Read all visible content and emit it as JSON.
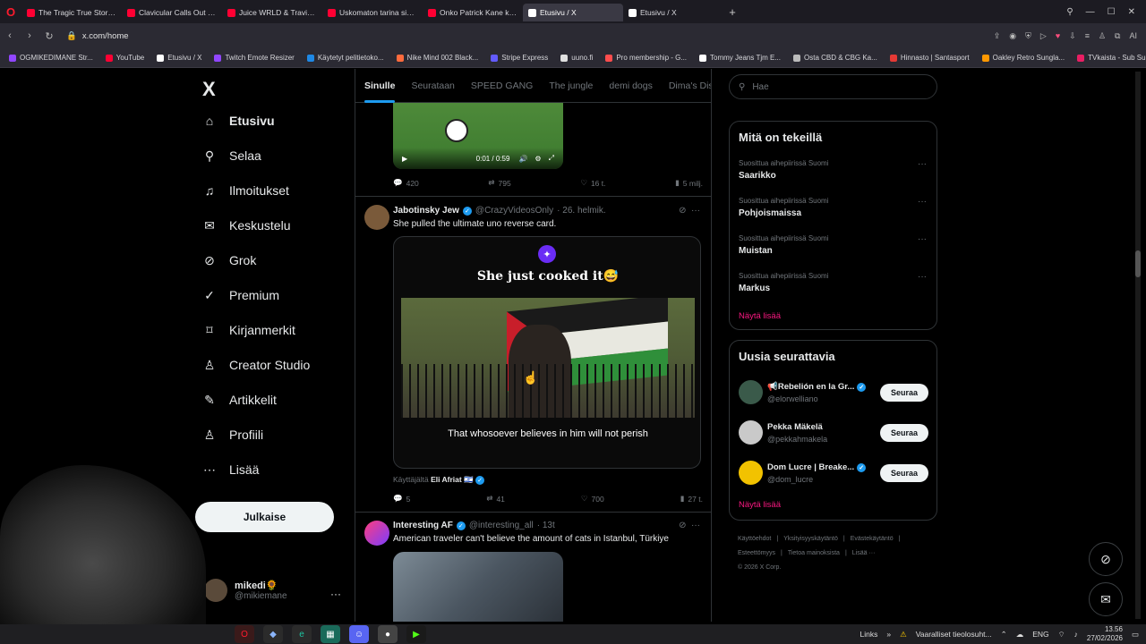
{
  "browser": {
    "tabs": [
      {
        "title": "The Tragic True Story of Ju",
        "color": "#ff0033"
      },
      {
        "title": "Clavicular Calls Out Larry",
        "color": "#ff0033"
      },
      {
        "title": "Juice WRLD & Travis Scott",
        "color": "#ff0033"
      },
      {
        "title": "Uskomaton tarina sinnikk",
        "color": "#ff0033"
      },
      {
        "title": "Onko Patrick Kane kaikkie",
        "color": "#ff0033"
      },
      {
        "title": "Etusivu / X",
        "color": "#ffffff",
        "active": true
      },
      {
        "title": "Etusivu / X",
        "color": "#ffffff"
      }
    ],
    "url": "x.com/home",
    "bookmarks": [
      {
        "label": "OGMIKEDIMANE Str...",
        "color": "#9146ff"
      },
      {
        "label": "YouTube",
        "color": "#ff0033"
      },
      {
        "label": "Etusivu / X",
        "color": "#ffffff"
      },
      {
        "label": "Twitch Emote Resizer",
        "color": "#9146ff"
      },
      {
        "label": "Käytetyt pelitietoko...",
        "color": "#1e88e5"
      },
      {
        "label": "Nike Mind 002 Black...",
        "color": "#ff6b3d"
      },
      {
        "label": "Stripe Express",
        "color": "#635bff"
      },
      {
        "label": "uuno.fi",
        "color": "#e0e0e0"
      },
      {
        "label": "Pro membership - G...",
        "color": "#ff4d4d"
      },
      {
        "label": "Tommy Jeans Tjm E...",
        "color": "#ffffff"
      },
      {
        "label": "Osta CBD & CBG Ka...",
        "color": "#bbbbbb"
      },
      {
        "label": "Hinnasto | Santasport",
        "color": "#e53935"
      },
      {
        "label": "Oakley Retro Sungla...",
        "color": "#ff9800"
      },
      {
        "label": "TVkaista - Sub Suora",
        "color": "#e91e63"
      }
    ]
  },
  "nav": {
    "logo": "X",
    "items": [
      {
        "label": "Etusivu",
        "icon": "home-icon",
        "glyph": "⌂",
        "active": true
      },
      {
        "label": "Selaa",
        "icon": "search-icon",
        "glyph": "⚲"
      },
      {
        "label": "Ilmoitukset",
        "icon": "bell-icon",
        "glyph": "♫"
      },
      {
        "label": "Keskustelu",
        "icon": "mail-icon",
        "glyph": "✉"
      },
      {
        "label": "Grok",
        "icon": "grok-icon",
        "glyph": "⊘"
      },
      {
        "label": "Premium",
        "icon": "verified-icon",
        "glyph": "✓"
      },
      {
        "label": "Kirjanmerkit",
        "icon": "bookmark-icon",
        "glyph": "⌑"
      },
      {
        "label": "Creator Studio",
        "icon": "creator-icon",
        "glyph": "♙"
      },
      {
        "label": "Artikkelit",
        "icon": "article-icon",
        "glyph": "✎"
      },
      {
        "label": "Profiili",
        "icon": "profile-icon",
        "glyph": "♙"
      },
      {
        "label": "Lisää",
        "icon": "more-icon",
        "glyph": "⋯"
      }
    ],
    "post_button": "Julkaise",
    "profile": {
      "name": "mikedi🌻",
      "handle": "@mikiemane"
    }
  },
  "feed": {
    "tabs": [
      "Sinulle",
      "Seurataan",
      "SPEED GANG",
      "The jungle",
      "demi dogs",
      "Dima's Dist"
    ],
    "post1": {
      "video_time": "0:01 / 0:59",
      "replies": "420",
      "reposts": "795",
      "likes": "16 t.",
      "views": "5 milj."
    },
    "post2": {
      "name": "Jabotinsky Jew",
      "handle": "@CrazyVideosOnly",
      "date": "· 26. helmik.",
      "text": "She pulled the ultimate uno reverse card.",
      "overlay_title": "She just cooked it😅",
      "caption": "That whosoever believes in him will not perish",
      "attribution_prefix": "Käyttäjältä",
      "attribution_name": "Eli Afriat 🇮🇱",
      "replies": "5",
      "reposts": "41",
      "likes": "700",
      "views": "27 t."
    },
    "post3": {
      "name": "Interesting AF",
      "handle": "@interesting_all",
      "date": "· 13t",
      "text": "American traveler can't believe the amount of cats in Istanbul, Türkiye"
    }
  },
  "sidebar": {
    "search_placeholder": "Hae",
    "trends_title": "Mitä on tekeillä",
    "trends": [
      {
        "context": "Suosittua aihepiirissä Suomi",
        "name": "Saarikko"
      },
      {
        "context": "Suosittua aihepiirissä Suomi",
        "name": "Pohjoismaissa"
      },
      {
        "context": "Suosittua aihepiirissä Suomi",
        "name": "Muistan"
      },
      {
        "context": "Suosittua aihepiirissä Suomi",
        "name": "Markus"
      }
    ],
    "show_more": "Näytä lisää",
    "who_title": "Uusia seurattavia",
    "who": [
      {
        "name": "📢Rebelión en la Gr...",
        "handle": "@elorwelliano",
        "button": "Seuraa",
        "color": "#3a5a4a"
      },
      {
        "name": "Pekka Mäkelä",
        "handle": "@pekkahmakela",
        "button": "Seuraa",
        "color": "#c9c9c9"
      },
      {
        "name": "Dom Lucre | Breake...",
        "handle": "@dom_lucre",
        "button": "Seuraa",
        "color": "#f2c200"
      }
    ],
    "footer": [
      "Käyttöehdot",
      "|",
      "Yksityisyyskäytäntö",
      "|",
      "Evästekäytäntö",
      "|",
      "Esteettömyys",
      "|",
      "Tietoa mainoksista",
      "|",
      "Lisää ···",
      "© 2026 X Corp."
    ]
  },
  "taskbar": {
    "links": "Links",
    "warning": "Vaaralliset tieolosuht...",
    "lang": "ENG",
    "time": "13.56",
    "date": "27/02/2026"
  }
}
